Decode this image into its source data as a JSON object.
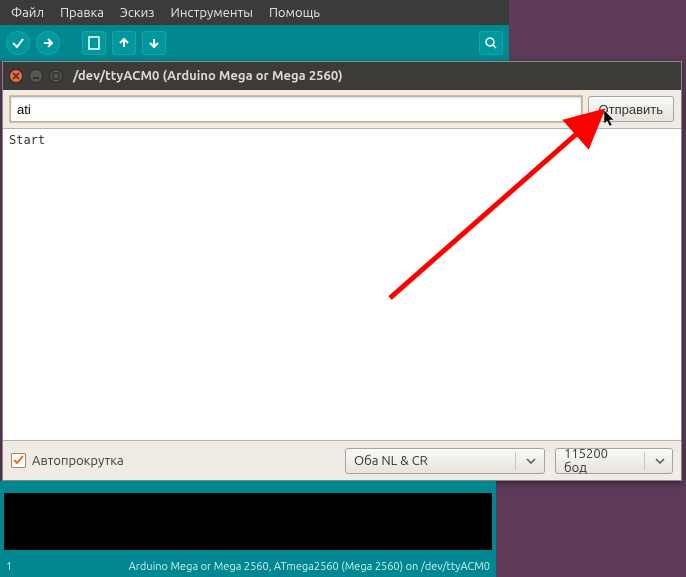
{
  "ide": {
    "menu": [
      "Файл",
      "Правка",
      "Эскиз",
      "Инструменты",
      "Помощь"
    ],
    "toolbar_icons": [
      "verify",
      "upload",
      "new",
      "open",
      "save",
      "serial-monitor"
    ]
  },
  "serial_monitor": {
    "title": "/dev/ttyACM0 (Arduino Mega or Mega 2560)",
    "input_value": "ati",
    "send_label": "Отправить",
    "output_text": "Start",
    "autoscroll_label": "Автопрокрутка",
    "autoscroll_checked": true,
    "line_ending": {
      "selected": "Оба NL & CR"
    },
    "baud": {
      "selected": "115200 бод"
    }
  },
  "status_bar": {
    "line_number": "1",
    "board_info": "Arduino Mega or Mega 2560, ATmega2560 (Mega 2560) on /dev/ttyACM0"
  },
  "annotation": {
    "arrow_color": "#ff0000"
  }
}
